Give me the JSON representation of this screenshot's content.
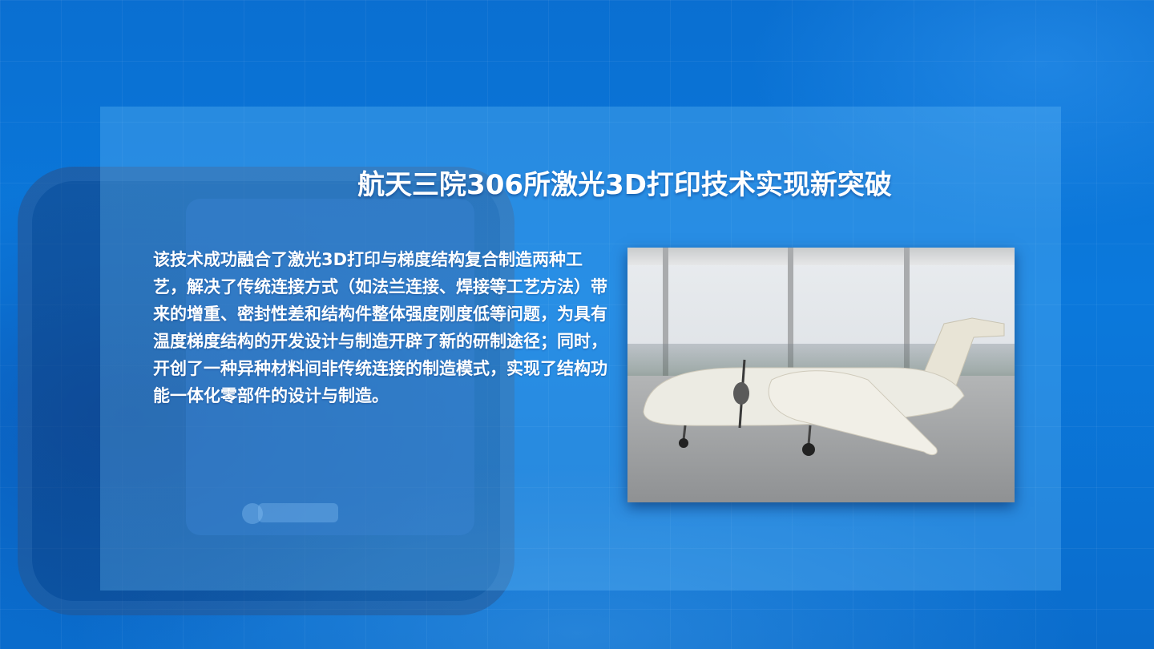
{
  "slide": {
    "title": "航天三院306所激光3D打印技术实现新突破",
    "body": "该技术成功融合了激光3D打印与梯度结构复合制造两种工艺，解决了传统连接方式（如法兰连接、焊接等工艺方法）带来的增重、密封性差和结构件整体强度刚度低等问题，为具有温度梯度结构的开发设计与制造开辟了新的研制途径；同时，开创了一种异种材料间非传统连接的制造模式，实现了结构功能一体化零部件的设计与制造。"
  },
  "colors": {
    "background": "#0b79dc",
    "panel": "rgba(120,200,255,0.28)",
    "text": "#ffffff"
  }
}
